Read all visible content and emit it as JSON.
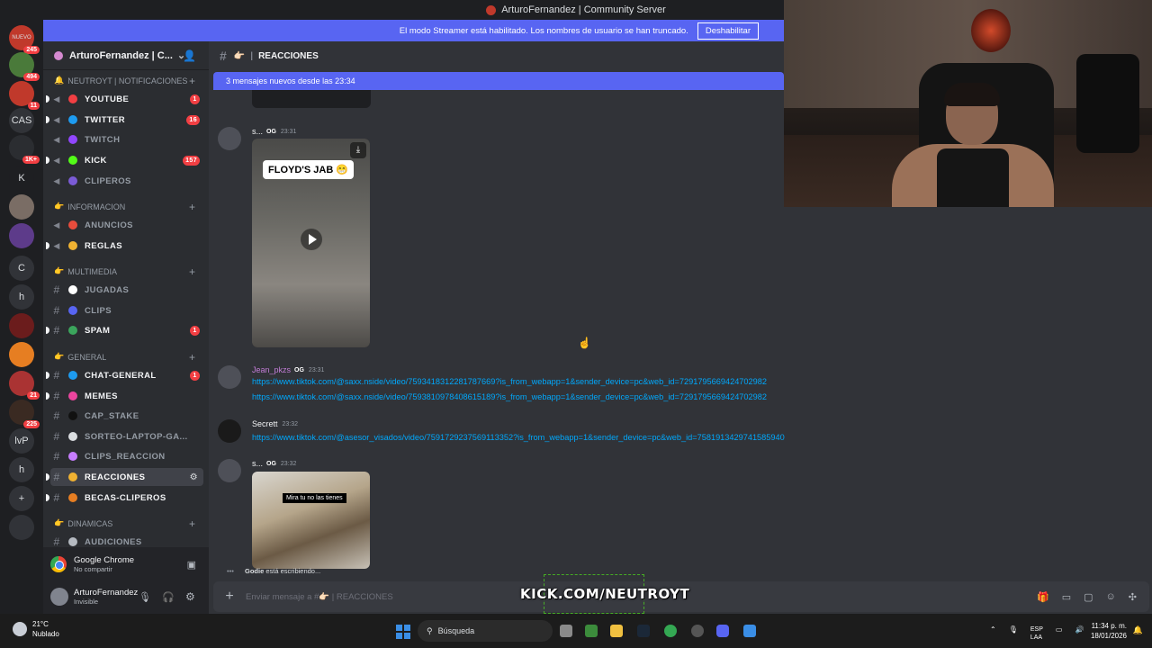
{
  "window": {
    "title": "ArturoFernandez | Community Server"
  },
  "streamer_banner": {
    "text": "El modo Streamer está habilitado. Los nombres de usuario se han truncado.",
    "button": "Deshabilitar"
  },
  "server_rail": {
    "items": [
      {
        "label": "NUEVO",
        "badge": "245"
      },
      {
        "label": "",
        "badge": "494"
      },
      {
        "label": "",
        "badge": "11"
      },
      {
        "label": "CAS",
        "badge": ""
      },
      {
        "label": "",
        "badge": "1K+"
      },
      {
        "label": "K",
        "badge": ""
      },
      {
        "label": "",
        "badge": ""
      },
      {
        "label": "",
        "badge": ""
      },
      {
        "label": "C",
        "badge": ""
      },
      {
        "label": "h",
        "badge": ""
      },
      {
        "label": "",
        "badge": ""
      },
      {
        "label": "",
        "badge": ""
      },
      {
        "label": "",
        "badge": "21"
      },
      {
        "label": "",
        "badge": "225"
      },
      {
        "label": "lvP",
        "badge": ""
      },
      {
        "label": "h",
        "badge": ""
      },
      {
        "label": "+",
        "badge": ""
      },
      {
        "label": "",
        "badge": ""
      }
    ]
  },
  "guild": {
    "name": "ArturoFernandez | C..."
  },
  "categories": [
    {
      "name": "NEUTROYT | NOTIFICACIONES",
      "prefix": "🔔"
    },
    {
      "name": "INFORMACION",
      "prefix": "👉"
    },
    {
      "name": "MULTIMEDIA",
      "prefix": "👉"
    },
    {
      "name": "GENERAL",
      "prefix": "👉"
    },
    {
      "name": "DINAMICAS",
      "prefix": "👉"
    }
  ],
  "channels": [
    {
      "name": "YOUTUBE",
      "badge": "1",
      "color": "#f23f43",
      "bold": true
    },
    {
      "name": "TWITTER",
      "badge": "16",
      "color": "#1d9bf0",
      "bold": true
    },
    {
      "name": "TWITCH",
      "badge": "",
      "color": "#9146ff",
      "bold": false
    },
    {
      "name": "KICK",
      "badge": "157",
      "color": "#53fc18",
      "bold": true
    },
    {
      "name": "CLIPEROS",
      "badge": "",
      "color": "#7b5bd6",
      "bold": false
    },
    {
      "name": "ANUNCIOS",
      "badge": "",
      "color": "#e74c3c",
      "bold": false
    },
    {
      "name": "REGLAS",
      "badge": "",
      "color": "#f0b232",
      "bold": true
    },
    {
      "name": "JUGADAS",
      "badge": "",
      "color": "#ffffff",
      "bold": false
    },
    {
      "name": "CLIPS",
      "badge": "",
      "color": "#5865f2",
      "bold": false
    },
    {
      "name": "SPAM",
      "badge": "1",
      "color": "#3ba55c",
      "bold": true
    },
    {
      "name": "CHAT-GENERAL",
      "badge": "1",
      "color": "#1d9bf0",
      "bold": true
    },
    {
      "name": "MEMES",
      "badge": "",
      "color": "#eb459e",
      "bold": true
    },
    {
      "name": "CAP_STAKE",
      "badge": "",
      "color": "#111111",
      "bold": false
    },
    {
      "name": "SORTEO-LAPTOP-GA...",
      "badge": "",
      "color": "#dbdee1",
      "bold": false
    },
    {
      "name": "CLIPS_REACCION",
      "badge": "",
      "color": "#c77dff",
      "bold": false
    },
    {
      "name": "REACCIONES",
      "badge": "",
      "color": "#f0b232",
      "bold": true
    },
    {
      "name": "BECAS-CLIPEROS",
      "badge": "",
      "color": "#e67e22",
      "bold": true
    },
    {
      "name": "AUDICIONES",
      "badge": "",
      "color": "#b5bac1",
      "bold": false
    }
  ],
  "activity": {
    "app": "Google Chrome",
    "status": "No compartir"
  },
  "user": {
    "name": "ArturoFernandez",
    "status": "Invisible"
  },
  "channel_header": {
    "name": "REACCIONES",
    "emoji": "👉🏻"
  },
  "new_messages_bar": "3 mensajes nuevos desde las 23:34",
  "messages": [
    {
      "author": "s...",
      "tag": "OG",
      "time": "23:31",
      "caption": "FLOYD'S JAB 😁"
    },
    {
      "author": "Jean_pkzs",
      "tag": "OG",
      "time": "23:31",
      "links": [
        "https://www.tiktok.com/@saxx.nside/video/7593418312281787669?is_from_webapp=1&sender_device=pc&web_id=7291795669424702982",
        "https://www.tiktok.com/@saxx.nside/video/7593810978408615189?is_from_webapp=1&sender_device=pc&web_id=7291795669424702982"
      ]
    },
    {
      "author": "Secrett",
      "tag": "",
      "time": "23:32",
      "links": [
        "https://www.tiktok.com/@asesor_visados/video/7591729237569113352?is_from_webapp=1&sender_device=pc&web_id=7581913429741585940"
      ]
    },
    {
      "author": "s...",
      "tag": "OG",
      "time": "23:32",
      "caption": "Mira tu no las tienes"
    }
  ],
  "typing": {
    "user": "Godie",
    "text": "está escribiendo..."
  },
  "composer": {
    "placeholder": "Enviar mensaje a #👉🏻 | REACCIONES"
  },
  "overlay": {
    "kick_text": "KICK.COM/NEUTROYT"
  },
  "taskbar": {
    "weather_temp": "21°C",
    "weather_desc": "Nublado",
    "search": "Búsqueda",
    "lang1": "ESP",
    "lang2": "LAA",
    "time": "11:34 p. m.",
    "date": "18/01/2026"
  }
}
